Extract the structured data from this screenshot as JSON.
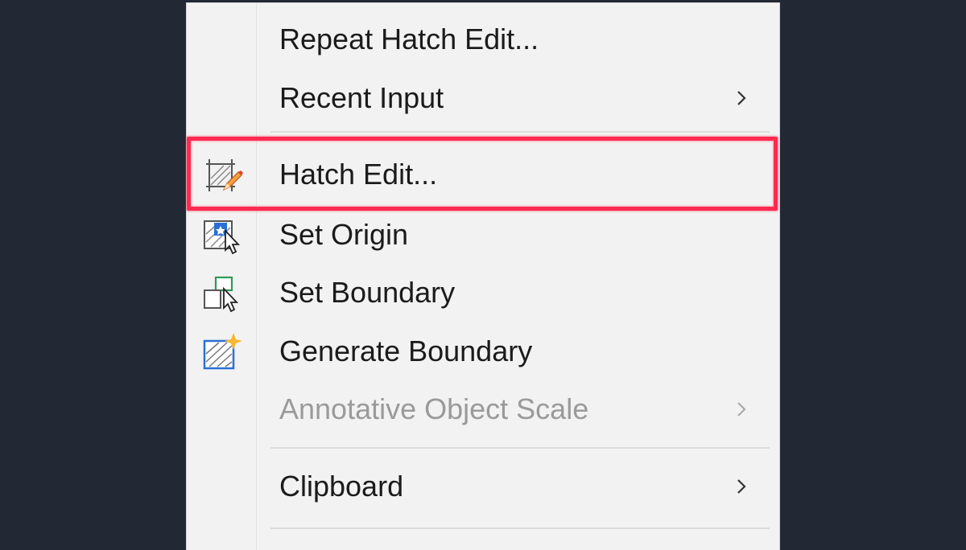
{
  "context_menu": {
    "items": [
      {
        "label": "Repeat Hatch Edit...",
        "has_submenu": false,
        "enabled": true
      },
      {
        "label": "Recent Input",
        "has_submenu": true,
        "enabled": true
      },
      {
        "label": "Hatch Edit...",
        "icon": "hatch-edit-icon",
        "has_submenu": false,
        "enabled": true,
        "highlighted": true
      },
      {
        "label": "Set Origin",
        "icon": "set-origin-icon",
        "has_submenu": false,
        "enabled": true
      },
      {
        "label": "Set Boundary",
        "icon": "set-boundary-icon",
        "has_submenu": false,
        "enabled": true
      },
      {
        "label": "Generate Boundary",
        "icon": "generate-boundary-icon",
        "has_submenu": false,
        "enabled": true
      },
      {
        "label": "Annotative Object Scale",
        "has_submenu": true,
        "enabled": false
      },
      {
        "label": "Clipboard",
        "has_submenu": true,
        "enabled": true
      }
    ]
  },
  "colors": {
    "background": "#222834",
    "menu_background": "#f2f2f2",
    "highlight_border": "#ff2a4f",
    "text": "#1b1b1b",
    "disabled_text": "#9a9a9a"
  }
}
